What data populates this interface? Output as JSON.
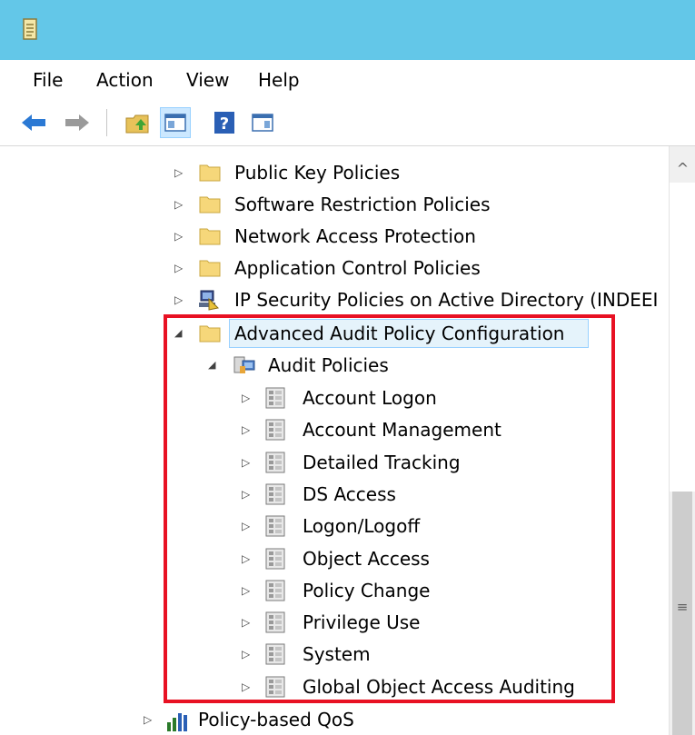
{
  "menu": {
    "file": "File",
    "action": "Action",
    "view": "View",
    "help": "Help"
  },
  "toolbar": {
    "icons": [
      "back-arrow-icon",
      "forward-arrow-icon",
      "up-folder-icon",
      "show-hide-tree-icon",
      "help-icon",
      "action-pane-icon"
    ]
  },
  "tree": {
    "gpo_children": [
      {
        "label": "Public Key Policies"
      },
      {
        "label": "Software Restriction Policies"
      },
      {
        "label": "Network Access Protection"
      },
      {
        "label": "Application Control Policies"
      },
      {
        "label": "IP Security Policies on Active Directory (INDEEI"
      }
    ],
    "advanced": {
      "label": "Advanced Audit Policy Configuration",
      "audit_policies": {
        "label": "Audit Policies",
        "children": [
          {
            "label": "Account Logon"
          },
          {
            "label": "Account Management"
          },
          {
            "label": "Detailed Tracking"
          },
          {
            "label": "DS Access"
          },
          {
            "label": "Logon/Logoff"
          },
          {
            "label": "Object Access"
          },
          {
            "label": "Policy Change"
          },
          {
            "label": "Privilege Use"
          },
          {
            "label": "System"
          },
          {
            "label": "Global Object Access Auditing"
          }
        ]
      }
    },
    "qos": {
      "label": "Policy-based QoS"
    }
  },
  "colors": {
    "titlebar": "#63c7e8",
    "highlight": "#e81123",
    "selection": "#e5f3fb",
    "folder": "#f6d77a"
  }
}
